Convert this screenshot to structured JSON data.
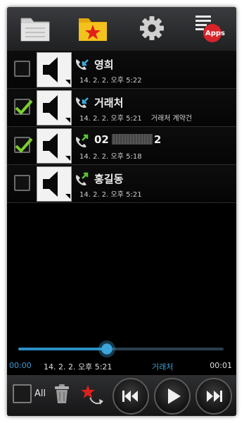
{
  "toolbar": {
    "buttons": [
      {
        "name": "folder",
        "icon": "folder-icon"
      },
      {
        "name": "favorites",
        "icon": "star-folder-icon"
      },
      {
        "name": "settings",
        "icon": "gear-icon"
      },
      {
        "name": "apps",
        "icon": "apps-menu-icon",
        "badge": "Apps"
      }
    ]
  },
  "recordings": [
    {
      "checked": false,
      "direction": "incoming",
      "name": "영희",
      "date": "14. 2. 2. 오후 5:22",
      "memo": ""
    },
    {
      "checked": true,
      "direction": "incoming",
      "name": "거래처",
      "date": "14. 2. 2. 오후 5:21",
      "memo": "거래처 계약건"
    },
    {
      "checked": true,
      "direction": "outgoing",
      "name_prefix": "02",
      "name_suffix": "2",
      "date": "14. 2. 2. 오후 5:18",
      "memo": ""
    },
    {
      "checked": false,
      "direction": "outgoing",
      "name": "홍길동",
      "date": "14. 2. 2. 오후 5:21",
      "memo": ""
    }
  ],
  "player": {
    "progress": 0.43,
    "current_time": "00:00",
    "date": "14. 2. 2. 오후 5:21",
    "name": "거래처",
    "duration": "00:01"
  },
  "controls": {
    "all_label": "All"
  },
  "colors": {
    "accent": "#2b8fc5",
    "check": "#7ccf2e",
    "badge": "#d9232b",
    "folder_yellow": "#f4c21c",
    "star_red": "#e0201b"
  }
}
